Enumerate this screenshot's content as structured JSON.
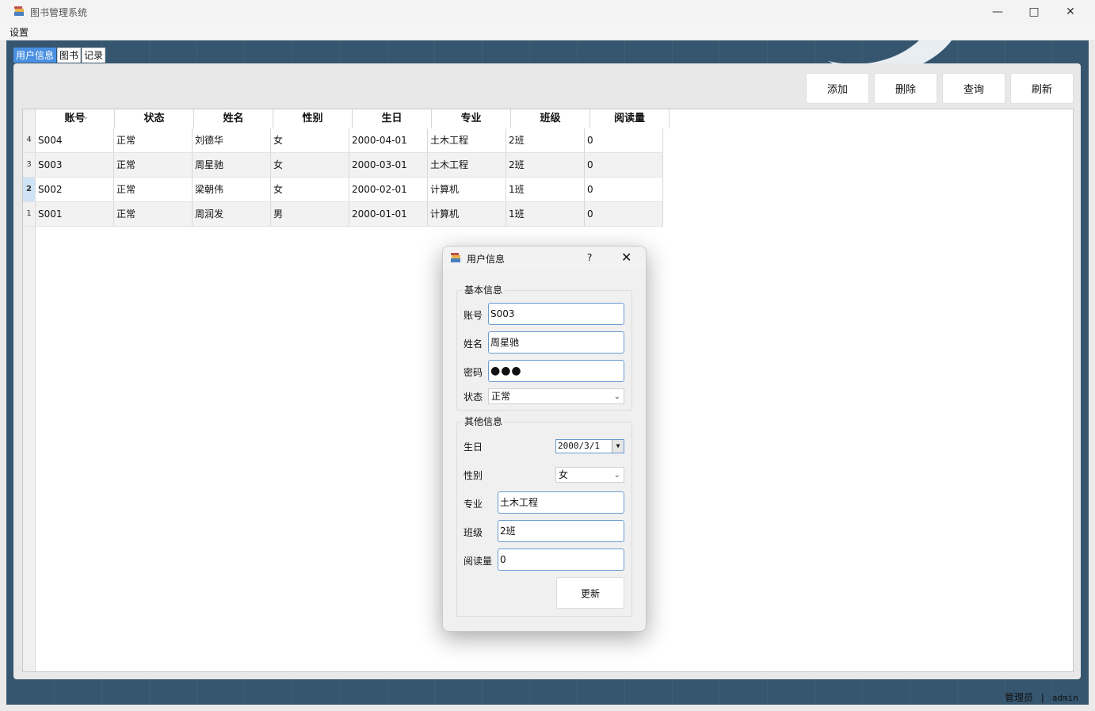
{
  "window": {
    "title": "图书管理系统",
    "menu": [
      "设置"
    ]
  },
  "tabs": [
    "用户信息",
    "图书",
    "记录"
  ],
  "toolbar": {
    "add": "添加",
    "delete": "删除",
    "query": "查询",
    "refresh": "刷新"
  },
  "table": {
    "columns": [
      "账号",
      "状态",
      "姓名",
      "性别",
      "生日",
      "专业",
      "班级",
      "阅读量"
    ],
    "rows": [
      {
        "num": "4",
        "cells": [
          "S004",
          "正常",
          "刘德华",
          "女",
          "2000-04-01",
          "土木工程",
          "2班",
          "0"
        ]
      },
      {
        "num": "3",
        "cells": [
          "S003",
          "正常",
          "周星驰",
          "女",
          "2000-03-01",
          "土木工程",
          "2班",
          "0"
        ]
      },
      {
        "num": "2",
        "cells": [
          "S002",
          "正常",
          "梁朝伟",
          "女",
          "2000-02-01",
          "计算机",
          "1班",
          "0"
        ]
      },
      {
        "num": "1",
        "cells": [
          "S001",
          "正常",
          "周润发",
          "男",
          "2000-01-01",
          "计算机",
          "1班",
          "0"
        ]
      }
    ]
  },
  "dialog": {
    "title": "用户信息",
    "help": "?",
    "basic": {
      "title": "基本信息",
      "account_label": "账号",
      "account_value": "S003",
      "name_label": "姓名",
      "name_value": "周星驰",
      "password_label": "密码",
      "password_value": "●●●",
      "status_label": "状态",
      "status_value": "正常"
    },
    "other": {
      "title": "其他信息",
      "birthday_label": "生日",
      "birthday_value": "2000/3/1",
      "gender_label": "性别",
      "gender_value": "女",
      "major_label": "专业",
      "major_value": "土木工程",
      "class_label": "班级",
      "class_value": "2班",
      "reads_label": "阅读量",
      "reads_value": "0"
    },
    "update": "更新"
  },
  "status": {
    "role": "管理员",
    "separator": "|",
    "user": "admin"
  }
}
